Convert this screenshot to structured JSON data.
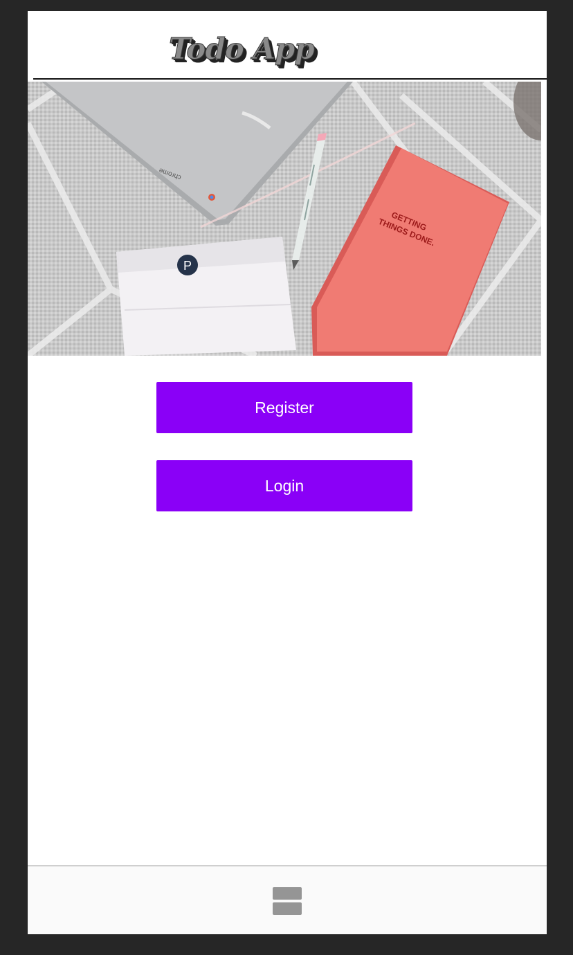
{
  "header": {
    "title": "Todo App"
  },
  "hero": {
    "description_icon": "hero-image",
    "notebook_text_line1": "GETTING",
    "notebook_text_line2": "THINGS DONE.",
    "laptop_brand": "chrome",
    "pouch_logo_letter": "P"
  },
  "actions": {
    "register_label": "Register",
    "login_label": "Login"
  },
  "footer": {
    "menu_icon": "menu-icon"
  },
  "colors": {
    "frame": "#262626",
    "primary": "#8a00f7",
    "button_text": "#ffffff",
    "footer_bg": "#fafafa",
    "notebook": "#f07b73"
  }
}
